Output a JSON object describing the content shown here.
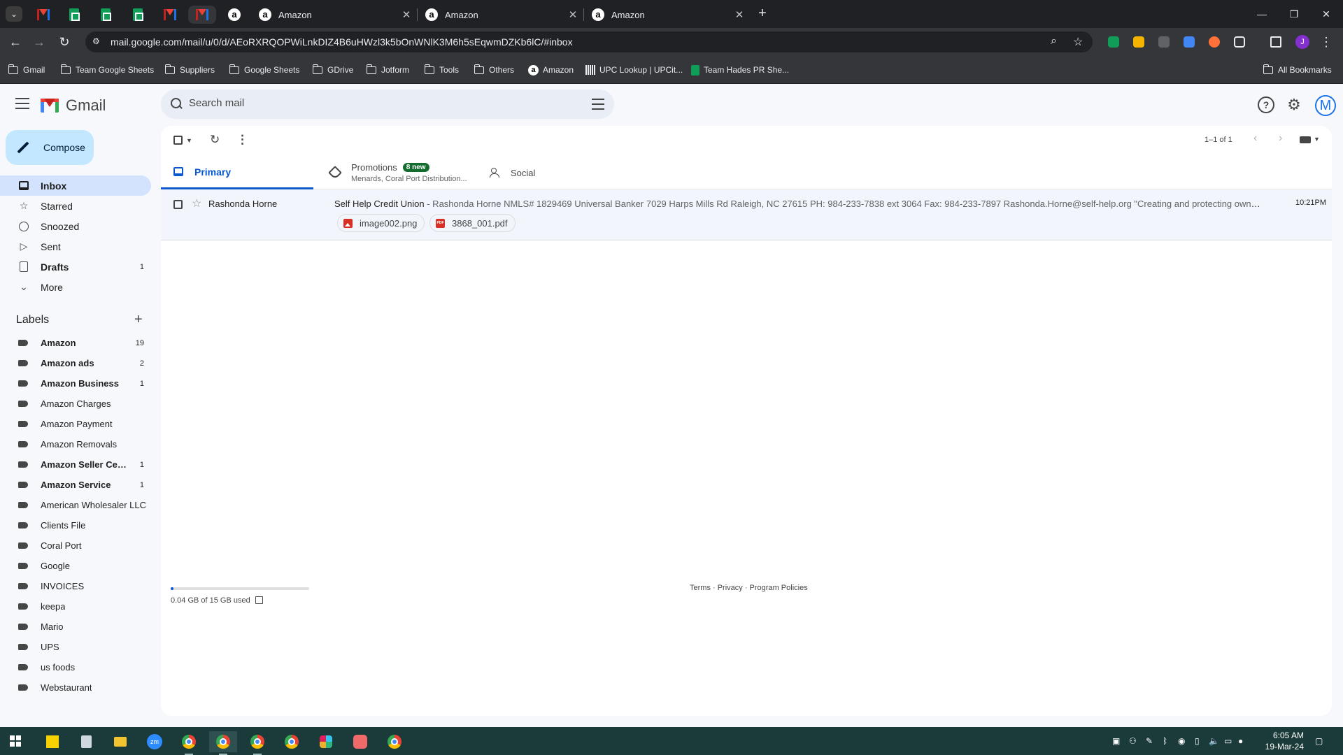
{
  "browser": {
    "tabs": [
      {
        "title": "Amazon",
        "close": "✕"
      },
      {
        "title": "Amazon",
        "close": "✕"
      },
      {
        "title": "Amazon",
        "close": "✕"
      }
    ],
    "new_tab": "+",
    "pinned_tabs": [
      "gmail",
      "sheets",
      "sheets",
      "sheets",
      "gmail",
      "gmail",
      "amazon"
    ],
    "address_url": "mail.google.com/mail/u/0/d/AEoRXRQOPWiLnkDIZ4B6uHWzl3k5bOnWNlK3M6h5sEqwmDZKb6lC/#inbox",
    "profile_initial": "J",
    "window_controls": {
      "minimize": "—",
      "restore": "❐",
      "close": "✕"
    }
  },
  "bookmarks": [
    {
      "label": "Gmail",
      "icon": "folder-icon"
    },
    {
      "label": "Team Google Sheets",
      "icon": "folder-icon"
    },
    {
      "label": "Suppliers",
      "icon": "folder-icon"
    },
    {
      "label": "Google Sheets",
      "icon": "folder-icon"
    },
    {
      "label": "GDrive",
      "icon": "folder-icon"
    },
    {
      "label": "Jotform",
      "icon": "folder-icon"
    },
    {
      "label": "Tools",
      "icon": "folder-icon"
    },
    {
      "label": "Others",
      "icon": "folder-icon"
    },
    {
      "label": "Amazon",
      "icon": "amazon-icon"
    },
    {
      "label": "UPC Lookup | UPCit...",
      "icon": "barcode-icon"
    },
    {
      "label": "Team Hades PR She...",
      "icon": "sheets-icon"
    },
    {
      "label": "All Bookmarks",
      "icon": "folder-icon"
    }
  ],
  "gmail": {
    "logo_text": "Gmail",
    "search_placeholder": "Search mail",
    "compose_label": "Compose",
    "avatar_initial": "M",
    "nav": [
      {
        "label": "Inbox",
        "count": "",
        "icon": "inbox-icon"
      },
      {
        "label": "Starred",
        "count": "",
        "icon": "star-icon"
      },
      {
        "label": "Snoozed",
        "count": "",
        "icon": "clock-icon"
      },
      {
        "label": "Sent",
        "count": "",
        "icon": "send-icon"
      },
      {
        "label": "Drafts",
        "count": "1",
        "icon": "draft-icon"
      },
      {
        "label": "More",
        "count": "",
        "icon": "chevron-down-icon"
      }
    ],
    "labels_title": "Labels",
    "labels": [
      {
        "name": "Amazon",
        "count": "19"
      },
      {
        "name": "Amazon ads",
        "count": "2"
      },
      {
        "name": "Amazon Business",
        "count": "1"
      },
      {
        "name": "Amazon Charges",
        "count": ""
      },
      {
        "name": "Amazon Payment",
        "count": ""
      },
      {
        "name": "Amazon Removals",
        "count": ""
      },
      {
        "name": "Amazon Seller Cent...",
        "count": "1"
      },
      {
        "name": "Amazon Service",
        "count": "1"
      },
      {
        "name": "American Wholesaler LLC",
        "count": ""
      },
      {
        "name": "Clients File",
        "count": ""
      },
      {
        "name": "Coral Port",
        "count": ""
      },
      {
        "name": "Google",
        "count": ""
      },
      {
        "name": "INVOICES",
        "count": ""
      },
      {
        "name": "keepa",
        "count": ""
      },
      {
        "name": "Mario",
        "count": ""
      },
      {
        "name": "UPS",
        "count": ""
      },
      {
        "name": "us foods",
        "count": ""
      },
      {
        "name": "Webstaurant",
        "count": ""
      }
    ],
    "pager_text": "1–1 of 1",
    "tabs": {
      "primary": "Primary",
      "promotions": "Promotions",
      "promotions_badge": "8 new",
      "promotions_sub": "Menards, Coral Port Distribution...",
      "social": "Social"
    },
    "emails": [
      {
        "sender": "Rashonda Horne",
        "subject": "Self Help Credit Union",
        "snippet": " - Rashonda Horne NMLS# 1829469 Universal Banker 7029 Harps Mills Rd Raleigh, NC 27615 PH: 984-233-7838 ext 3064 Fax: 984-233-7897 Rashonda.Horne@self-help.org \"Creating and protecting ownership a...",
        "time": "10:21PM",
        "attachments": [
          "image002.png",
          "3868_001.pdf"
        ]
      }
    ],
    "storage_text": "0.04 GB of 15 GB used",
    "storage_fraction": 0.003,
    "footer": "Terms · Privacy · Program Policies"
  },
  "taskbar": {
    "time": "6:05 AM",
    "date": "19-Mar-24"
  },
  "colors": {
    "accent": "#0b57d0",
    "compose_bg": "#c2e7ff",
    "inbox_active": "#d3e3fd",
    "promo_badge": "#146c2e"
  }
}
